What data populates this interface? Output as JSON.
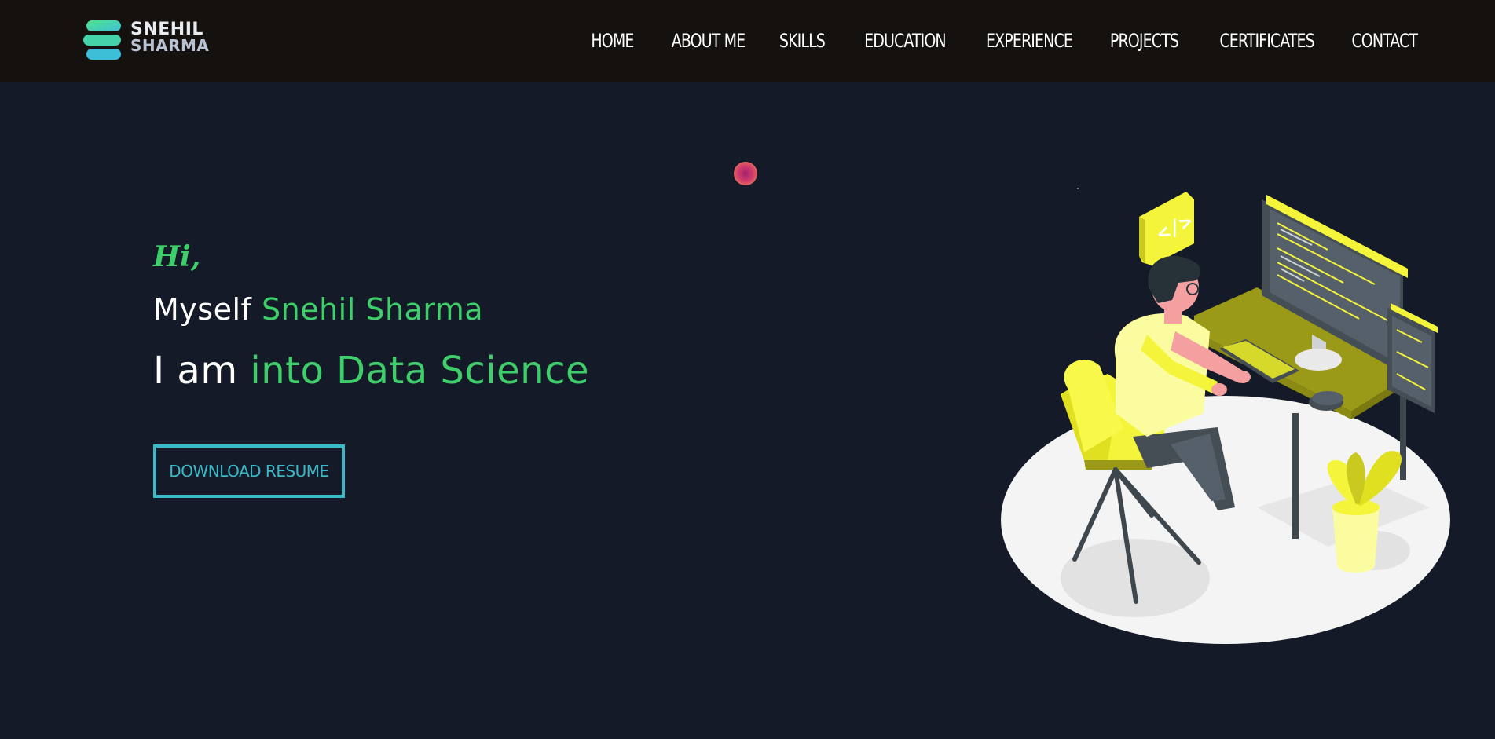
{
  "header": {
    "logo_line1": "SNEHIL",
    "logo_line2": "SHARMA",
    "nav": [
      "HOME",
      "ABOUT ME",
      "SKILLS",
      "EDUCATION",
      "EXPERIENCE",
      "PROJECTS",
      "CERTIFICATES",
      "CONTACT"
    ]
  },
  "hero": {
    "greeting": "Hi,",
    "myself_prefix": "Myself",
    "name": "Snehil Sharma",
    "iam_prefix": "I am",
    "role": "into Data Science",
    "button_label": "DOWNLOAD RESUME",
    "illustration_alt": "developer-at-desk-illustration",
    "code_bubble_text": "</>"
  },
  "colors": {
    "navbar_bg": "#15110f",
    "page_bg": "#151a28",
    "accent_green": "#3ecf6b",
    "accent_cyan": "#3ab9c9",
    "illustration_yellow": "#f4f53a"
  }
}
